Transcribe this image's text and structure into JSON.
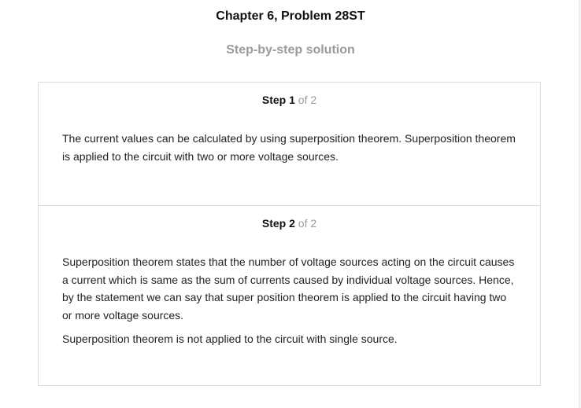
{
  "header": {
    "title": "Chapter 6, Problem 28ST",
    "subtitle": "Step-by-step solution"
  },
  "steps": [
    {
      "word": "Step",
      "number": "1",
      "of_total": "of 2",
      "paragraphs": [
        "The current values can be calculated by using superposition theorem. Superposition theorem is applied to the circuit with two or more voltage sources."
      ]
    },
    {
      "word": "Step",
      "number": "2",
      "of_total": "of 2",
      "paragraphs": [
        "Superposition theorem states that the number of voltage sources acting on the circuit causes a current which is same as the sum of currents caused by individual voltage sources. Hence, by the statement we can say that super position theorem is applied to the circuit having two or more voltage sources.",
        "Superposition theorem is not applied to the circuit with single source."
      ]
    }
  ]
}
